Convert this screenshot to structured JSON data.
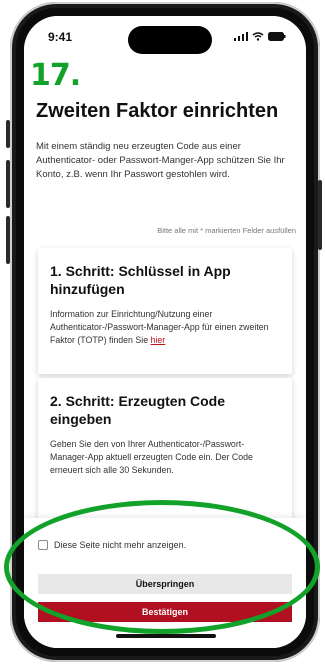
{
  "annotation": {
    "step_number": "17."
  },
  "status_bar": {
    "time": "9:41",
    "icons": "..ıl ≋ ▬"
  },
  "page": {
    "title": "Zweiten Faktor einrichten",
    "intro": "Mit einem ständig neu erzeugten Code aus einer Authenticator- oder Passwort-Manger-App schützen Sie Ihr Konto, z.B. wenn Ihr Passwort gestohlen wird.",
    "required_note": "Bitte alle mit * markierten Felder ausfüllen"
  },
  "cards": [
    {
      "heading": "1. Schritt: Schlüssel in App hinzufügen",
      "text": "Information zur Einrichtung/Nutzung einer Authenticator-/Passwort-Manager-App für einen zweiten Faktor (TOTP) finden Sie ",
      "link": "hier"
    },
    {
      "heading": "2. Schritt: Erzeugten Code eingeben",
      "text": "Geben Sie den von Ihrer Authenticator-/Passwort-Manager-App aktuell erzeugten Code ein. Der Code erneuert sich alle 30 Sekunden."
    }
  ],
  "footer": {
    "checkbox_label": "Diese Seite nicht mehr anzeigen.",
    "checkbox_checked": false,
    "skip_label": "Überspringen",
    "confirm_label": "Bestätigen"
  },
  "colors": {
    "annotation_green": "#12a22a",
    "confirm_red": "#b01020",
    "link_red": "#c0141e"
  }
}
